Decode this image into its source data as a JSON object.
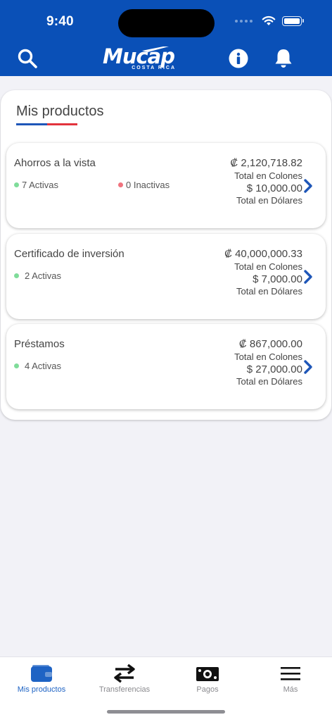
{
  "status": {
    "time": "9:40"
  },
  "header": {
    "logo_text": "Mucap",
    "logo_sub": "COSTA RICA",
    "colors": {
      "brand": "#0a50b7",
      "accent_red": "#e2333d"
    }
  },
  "section": {
    "title": "Mis productos"
  },
  "products": [
    {
      "name": "Ahorros a la vista",
      "active": "7 Activas",
      "inactive": "0 Inactivas",
      "amount_colones": "₡ 2,120,718.82",
      "label_colones": "Total en Colones",
      "amount_dolares": "$ 10,000.00",
      "label_dolares": "Total en Dólares"
    },
    {
      "name": "Certificado de inversión",
      "active": "2 Activas",
      "amount_colones": "₡ 40,000,000.33",
      "label_colones": "Total en Colones",
      "amount_dolares": "$ 7,000.00",
      "label_dolares": "Total en Dólares"
    },
    {
      "name": "Préstamos",
      "active": "4 Activas",
      "amount_colones": "₡ 867,000.00",
      "label_colones": "Total en Colones",
      "amount_dolares": "$ 27,000.00",
      "label_dolares": "Total en Dólares"
    }
  ],
  "tabs": [
    {
      "label": "Mis productos",
      "icon": "wallet-icon",
      "active": true
    },
    {
      "label": "Transferencias",
      "icon": "transfer-arrows-icon"
    },
    {
      "label": "Pagos",
      "icon": "money-bill-icon"
    },
    {
      "label": "Más",
      "icon": "menu-icon"
    }
  ]
}
